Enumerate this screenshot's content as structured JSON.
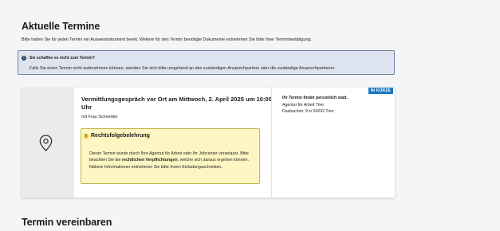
{
  "page": {
    "heading": "Aktuelle Termine",
    "intro": "Bitte halten Sie für jeden Termin ein Ausweisdokument bereit. Weitere für den Termin benötigte Dokumente entnehmen Sie bitte Ihrer Terminbestätigung.",
    "section2_heading": "Termin vereinbaren"
  },
  "info": {
    "icon": "info-icon",
    "title": "Sie schaffen es nicht zum Termin?",
    "text": "Falls Sie einen Termin nicht wahrnehmen können, wenden Sie sich bitte umgehend an den zuständigen Ansprechpartner oder die zuständige Ansprechpartnerin."
  },
  "appointment": {
    "badge": "IN KÜRZE",
    "title": "Vermittlungsgespräch vor Ort am Mittwoch, 2. April 2025 um 10:00 Uhr",
    "with": "mit Frau Schneider",
    "location_icon": "map-pin-icon",
    "legal": {
      "icon": "warning-icon",
      "title": "Rechtsfolgebelehrung",
      "text_before": "Dieser Termin wurde durch Ihre Agentur für Arbeit oder Ihr Jobcenter veranlasst. Bitte beachten Sie die ",
      "text_bold": "rechtlichen Verpflichtungen",
      "text_after": ", welche sich daraus ergeben können. Nähere Informationen entnehmen Sie bitte Ihrem Einladungsschreiben."
    },
    "side": {
      "title": "Ihr Termin findet persönlich statt.",
      "office": "Agentur für Arbeit Trier",
      "address": "Dasbachstr. 9 in 54292 Trier"
    }
  },
  "colors": {
    "badge": "#1a78c2",
    "info_bg": "#dde4ef",
    "legal_bg": "#fdf6c3"
  }
}
